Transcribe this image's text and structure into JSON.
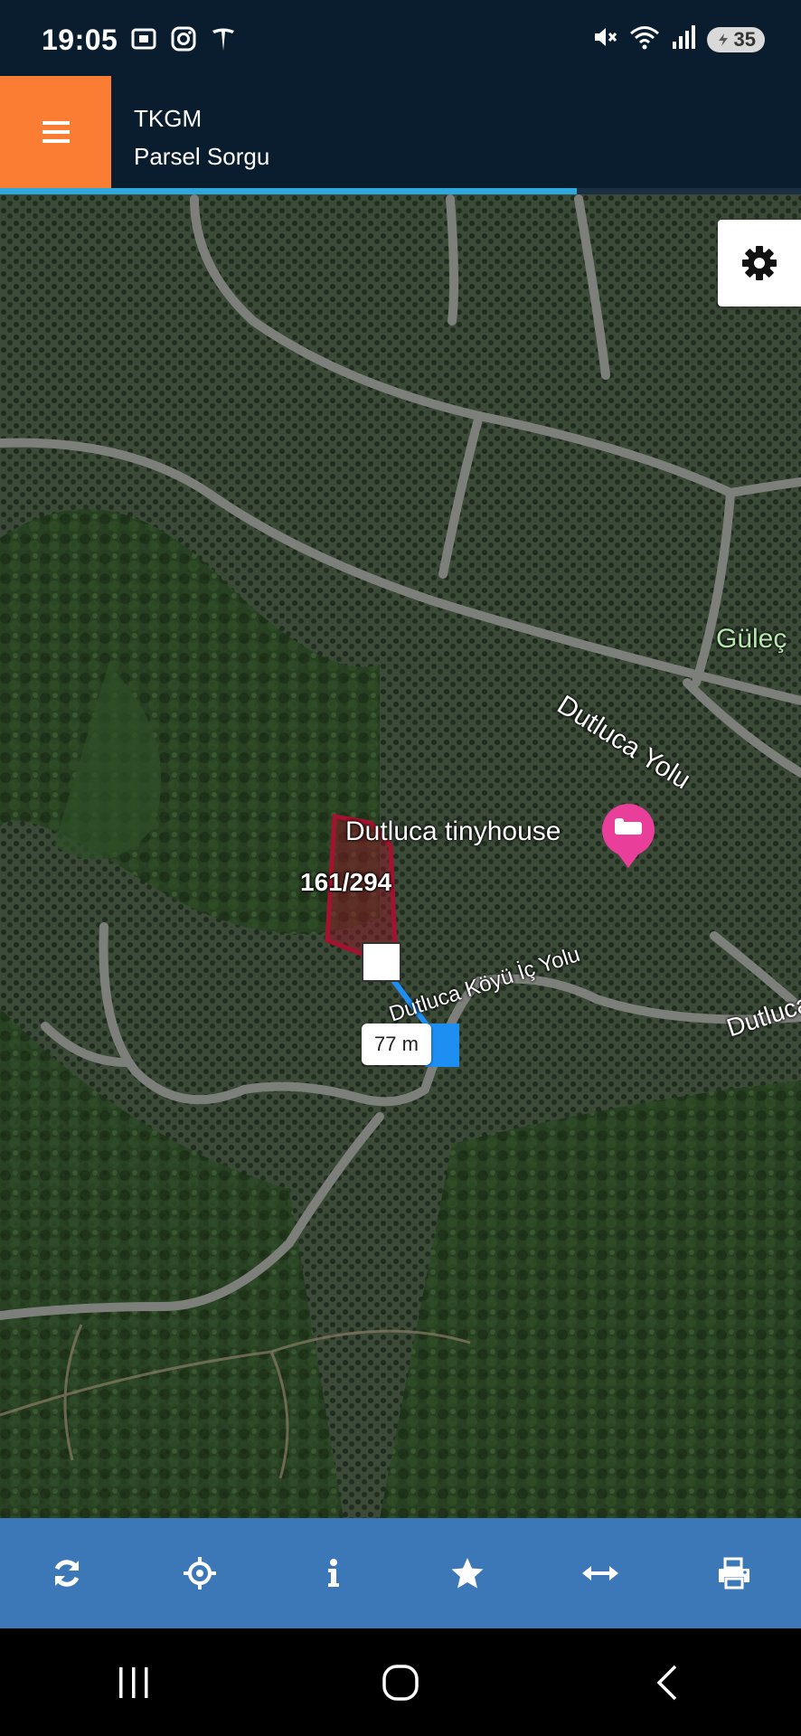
{
  "status_bar": {
    "time": "19:05",
    "battery": "35",
    "icons_left": [
      "screenshot-icon",
      "instagram-icon",
      "tesla-icon"
    ],
    "icons_right": [
      "mute-icon",
      "wifi-icon",
      "signal-icon",
      "battery-icon"
    ]
  },
  "header": {
    "title": "TKGM",
    "subtitle": "Parsel Sorgu",
    "accent_color": "#fb7d33",
    "background": "#0a1d2e"
  },
  "progress": {
    "fraction": 0.72,
    "color": "#2ea7dd"
  },
  "map": {
    "labels": {
      "guleç": "Güleç",
      "dutluca_yolu": "Dutluca Yolu",
      "tinyhouse": "Dutluca tinyhouse",
      "koyu_ic_yolu": "Dutluca Köyü İç Yolu",
      "dutluca_right": "Dutluca"
    },
    "parcel": "161/294",
    "measurement": "77 m"
  },
  "toolbar": {
    "background": "#3c78b8",
    "items": [
      "refresh-icon",
      "locate-icon",
      "info-icon",
      "star-icon",
      "measure-icon",
      "print-icon"
    ]
  },
  "nav": {
    "items": [
      "recents-icon",
      "home-icon",
      "back-icon"
    ]
  }
}
